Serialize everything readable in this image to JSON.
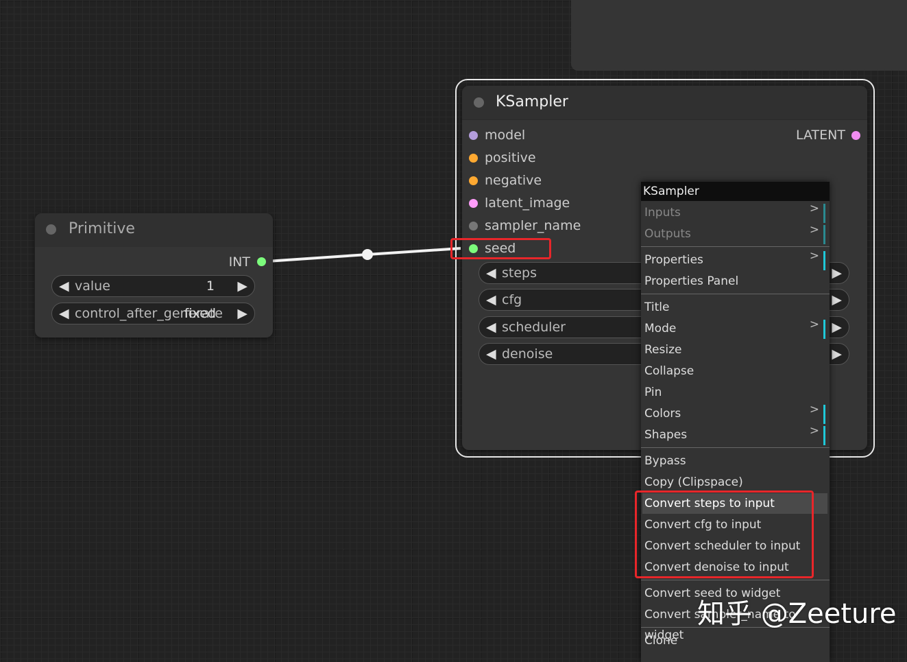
{
  "ksampler": {
    "title": "KSampler",
    "output": "LATENT",
    "output_color": "#f08cf0",
    "inputs": [
      {
        "label": "model",
        "color": "#b39ddb"
      },
      {
        "label": "positive",
        "color": "#ffa931"
      },
      {
        "label": "negative",
        "color": "#ffa931"
      },
      {
        "label": "latent_image",
        "color": "#ff9cf9"
      },
      {
        "label": "sampler_name",
        "color": "#777777"
      },
      {
        "label": "seed",
        "color": "#7cfc7c"
      }
    ],
    "widgets": [
      "steps",
      "cfg",
      "scheduler",
      "denoise"
    ]
  },
  "primitive": {
    "title": "Primitive",
    "output": "INT",
    "output_color": "#7cfc7c",
    "widgets": [
      {
        "name": "value",
        "value": "1"
      },
      {
        "name": "control_after_generate",
        "value": "fixed"
      }
    ]
  },
  "menu": {
    "title": "KSampler",
    "items": [
      {
        "label": "Inputs",
        "submenu": true,
        "disabled": true
      },
      {
        "label": "Outputs",
        "submenu": true,
        "disabled": true
      },
      {
        "sep": true
      },
      {
        "label": "Properties",
        "submenu": true
      },
      {
        "label": "Properties Panel"
      },
      {
        "sep": true
      },
      {
        "label": "Title"
      },
      {
        "label": "Mode",
        "submenu": true
      },
      {
        "label": "Resize"
      },
      {
        "label": "Collapse"
      },
      {
        "label": "Pin"
      },
      {
        "label": "Colors",
        "submenu": true
      },
      {
        "label": "Shapes",
        "submenu": true
      },
      {
        "sep": true
      },
      {
        "label": "Bypass"
      },
      {
        "label": "Copy (Clipspace)"
      },
      {
        "label": "Convert steps to input",
        "highlighted": true
      },
      {
        "label": "Convert cfg to input"
      },
      {
        "label": "Convert scheduler to input"
      },
      {
        "label": "Convert denoise to input"
      },
      {
        "sep": true
      },
      {
        "label": "Convert seed to widget"
      },
      {
        "label": "Convert sampler_name to widget"
      },
      {
        "sep": true
      },
      {
        "label": "Clone"
      }
    ]
  },
  "watermark": "知乎 @Zeeture",
  "icons": {
    "left_arrow": "◀",
    "right_arrow": "▶",
    "submenu": ">"
  }
}
